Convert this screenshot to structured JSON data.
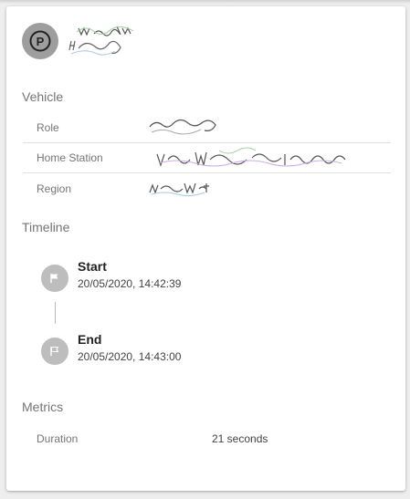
{
  "header": {
    "avatar_icon": "parking-icon"
  },
  "vehicle": {
    "title": "Vehicle",
    "rows": [
      {
        "label": "Role"
      },
      {
        "label": "Home Station"
      },
      {
        "label": "Region"
      }
    ]
  },
  "timeline": {
    "title": "Timeline",
    "items": [
      {
        "title": "Start",
        "time": "20/05/2020, 14:42:39",
        "icon": "flag-icon"
      },
      {
        "title": "End",
        "time": "20/05/2020, 14:43:00",
        "icon": "flag-outline-icon"
      }
    ]
  },
  "metrics": {
    "title": "Metrics",
    "rows": [
      {
        "label": "Duration",
        "value": "21 seconds"
      }
    ]
  }
}
